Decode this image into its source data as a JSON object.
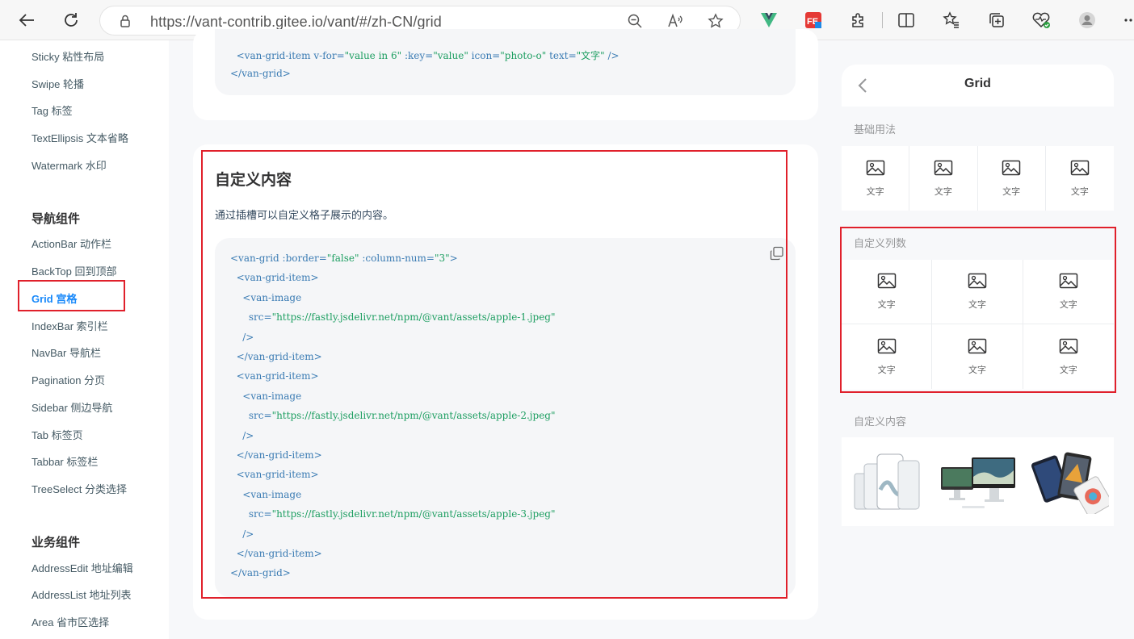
{
  "browser": {
    "url": "https://vant-contrib.gitee.io/vant/#/zh-CN/grid"
  },
  "sidebar": {
    "items_top": [
      "Sticky 粘性布局",
      "Swipe 轮播",
      "Tag 标签",
      "TextEllipsis 文本省略",
      "Watermark 水印"
    ],
    "group_nav": "导航组件",
    "items_nav": [
      "ActionBar 动作栏",
      "BackTop 回到顶部",
      "Grid 宫格",
      "IndexBar 索引栏",
      "NavBar 导航栏",
      "Pagination 分页",
      "Sidebar 侧边导航",
      "Tab 标签页",
      "Tabbar 标签栏",
      "TreeSelect 分类选择"
    ],
    "group_biz": "业务组件",
    "items_biz": [
      "AddressEdit 地址编辑",
      "AddressList 地址列表",
      "Area 省市区选择"
    ]
  },
  "main": {
    "prev_code": [
      {
        "t": "  <van-grid-item v-for=\"value in 6\" :key=\"value\" icon=\"photo-o\" text=\"文字\" />"
      },
      {
        "t": "</van-grid>"
      }
    ],
    "section_title": "自定义内容",
    "section_desc": "通过插槽可以自定义格子展示的内容。",
    "code": [
      "<van-grid :border=\"false\" :column-num=\"3\">",
      "  <van-grid-item>",
      "    <van-image",
      "      src=\"https://fastly.jsdelivr.net/npm/@vant/assets/apple-1.jpeg\"",
      "    />",
      "  </van-grid-item>",
      "  <van-grid-item>",
      "    <van-image",
      "      src=\"https://fastly.jsdelivr.net/npm/@vant/assets/apple-2.jpeg\"",
      "    />",
      "  </van-grid-item>",
      "  <van-grid-item>",
      "    <van-image",
      "      src=\"https://fastly.jsdelivr.net/npm/@vant/assets/apple-3.jpeg\"",
      "    />",
      "  </van-grid-item>",
      "</van-grid>"
    ]
  },
  "phone": {
    "title": "Grid",
    "label_basic": "基础用法",
    "label_columns": "自定义列数",
    "label_custom": "自定义内容",
    "cell_text": "文字"
  },
  "colors": {
    "accent": "#1989fa",
    "highlight": "#e0202b"
  }
}
